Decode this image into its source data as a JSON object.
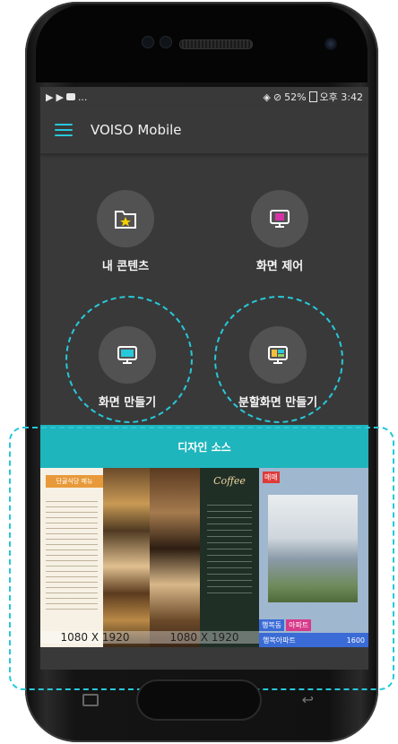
{
  "statusbar": {
    "left_icons": [
      "play-icon",
      "play-icon",
      "youtube-icon"
    ],
    "left_text": "...",
    "right_text": "52%",
    "clock": "오후 3:42"
  },
  "appbar": {
    "title": "VOISO Mobile"
  },
  "menu": {
    "my_content": "내 콘텐츠",
    "screen_control": "화면 제어",
    "make_screen": "화면 만들기",
    "make_split_screen": "분할화면 만들기"
  },
  "design": {
    "header": "디자인 소스",
    "thumbs": [
      {
        "title": "단골식당 메뉴",
        "res": "1080 X 1920"
      },
      {
        "title": "Coffee",
        "res": "1080 X 1920"
      },
      {
        "title": "매매",
        "tag1": "행복동",
        "tag2": "아파트",
        "footer": "행복아파트",
        "price": "1600"
      }
    ]
  },
  "colors": {
    "accent": "#27c8d9",
    "header": "#1fb5bd",
    "screen_bg": "#393939"
  }
}
